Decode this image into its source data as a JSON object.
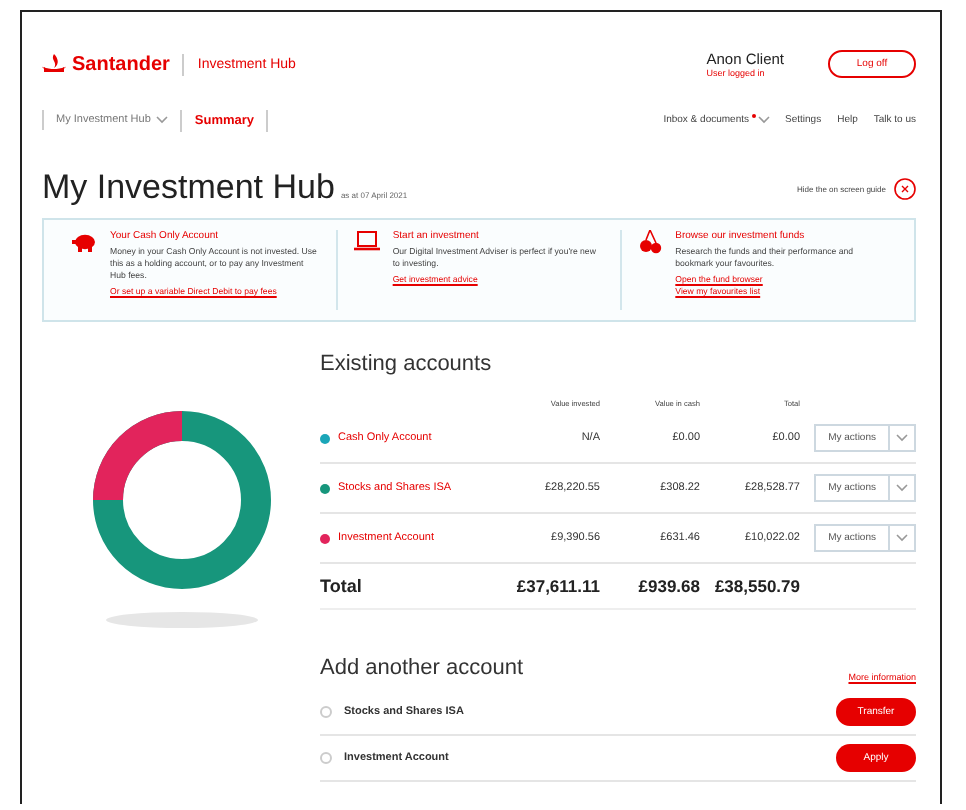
{
  "header": {
    "brand": "Santander",
    "product": "Investment Hub",
    "user": "Anon Client",
    "user_status": "User logged in",
    "logoff_button": "Log off"
  },
  "nav": {
    "left": [
      {
        "label": "My Investment Hub",
        "dropdown": true,
        "selected": false
      },
      {
        "label": "Summary",
        "dropdown": false,
        "selected": true
      }
    ],
    "right": [
      {
        "label": "Inbox & documents",
        "dropdown": true,
        "alert": true
      },
      {
        "label": "Settings",
        "dropdown": false,
        "alert": false
      },
      {
        "label": "Help",
        "dropdown": false,
        "alert": false
      },
      {
        "label": "Talk to us",
        "dropdown": false,
        "alert": false
      }
    ]
  },
  "page": {
    "title": "My Investment Hub",
    "date": "as at 07 April 2021",
    "guide_toggle": "Hide the on screen guide"
  },
  "guide_cards": [
    {
      "title": "Your Cash Only Account",
      "body": "Money in your Cash Only Account is not invested. Use this as a holding account, or to pay any Investment Hub fees.",
      "links": [
        "Or set up a variable Direct Debit to pay fees"
      ]
    },
    {
      "title": "Start an investment",
      "body": "Our Digital Investment Adviser is perfect if you're new to investing.",
      "links": [
        "Get investment advice"
      ]
    },
    {
      "title": "Browse our investment funds",
      "body": "Research the funds and their performance and bookmark your favourites.",
      "links": [
        "Open the fund browser",
        "View my favourites list"
      ]
    }
  ],
  "existing_accounts": {
    "title": "Existing accounts",
    "columns": [
      "Value invested",
      "Value in cash",
      "Total"
    ],
    "rows": [
      {
        "name": "Cash Only Account",
        "color": "#1ba6b8",
        "values": [
          "N/A",
          "£0.00",
          "£0.00"
        ],
        "action": "My actions"
      },
      {
        "name": "Stocks and Shares ISA",
        "color": "#17967c",
        "values": [
          "£28,220.55",
          "£308.22",
          "£28,528.77"
        ],
        "action": "My actions"
      },
      {
        "name": "Investment Account",
        "color": "#e2245c",
        "values": [
          "£9,390.56",
          "£631.46",
          "£10,022.02"
        ],
        "action": "My actions"
      }
    ],
    "total": {
      "label": "Total",
      "values": [
        "£37,611.11",
        "£939.68",
        "£38,550.79"
      ]
    }
  },
  "add_account": {
    "title": "Add another account",
    "more_link": "More information",
    "rows": [
      {
        "name": "Stocks and Shares ISA",
        "selected": false,
        "button": "Transfer"
      },
      {
        "name": "Investment Account",
        "selected": false,
        "button": "Apply"
      }
    ]
  }
}
